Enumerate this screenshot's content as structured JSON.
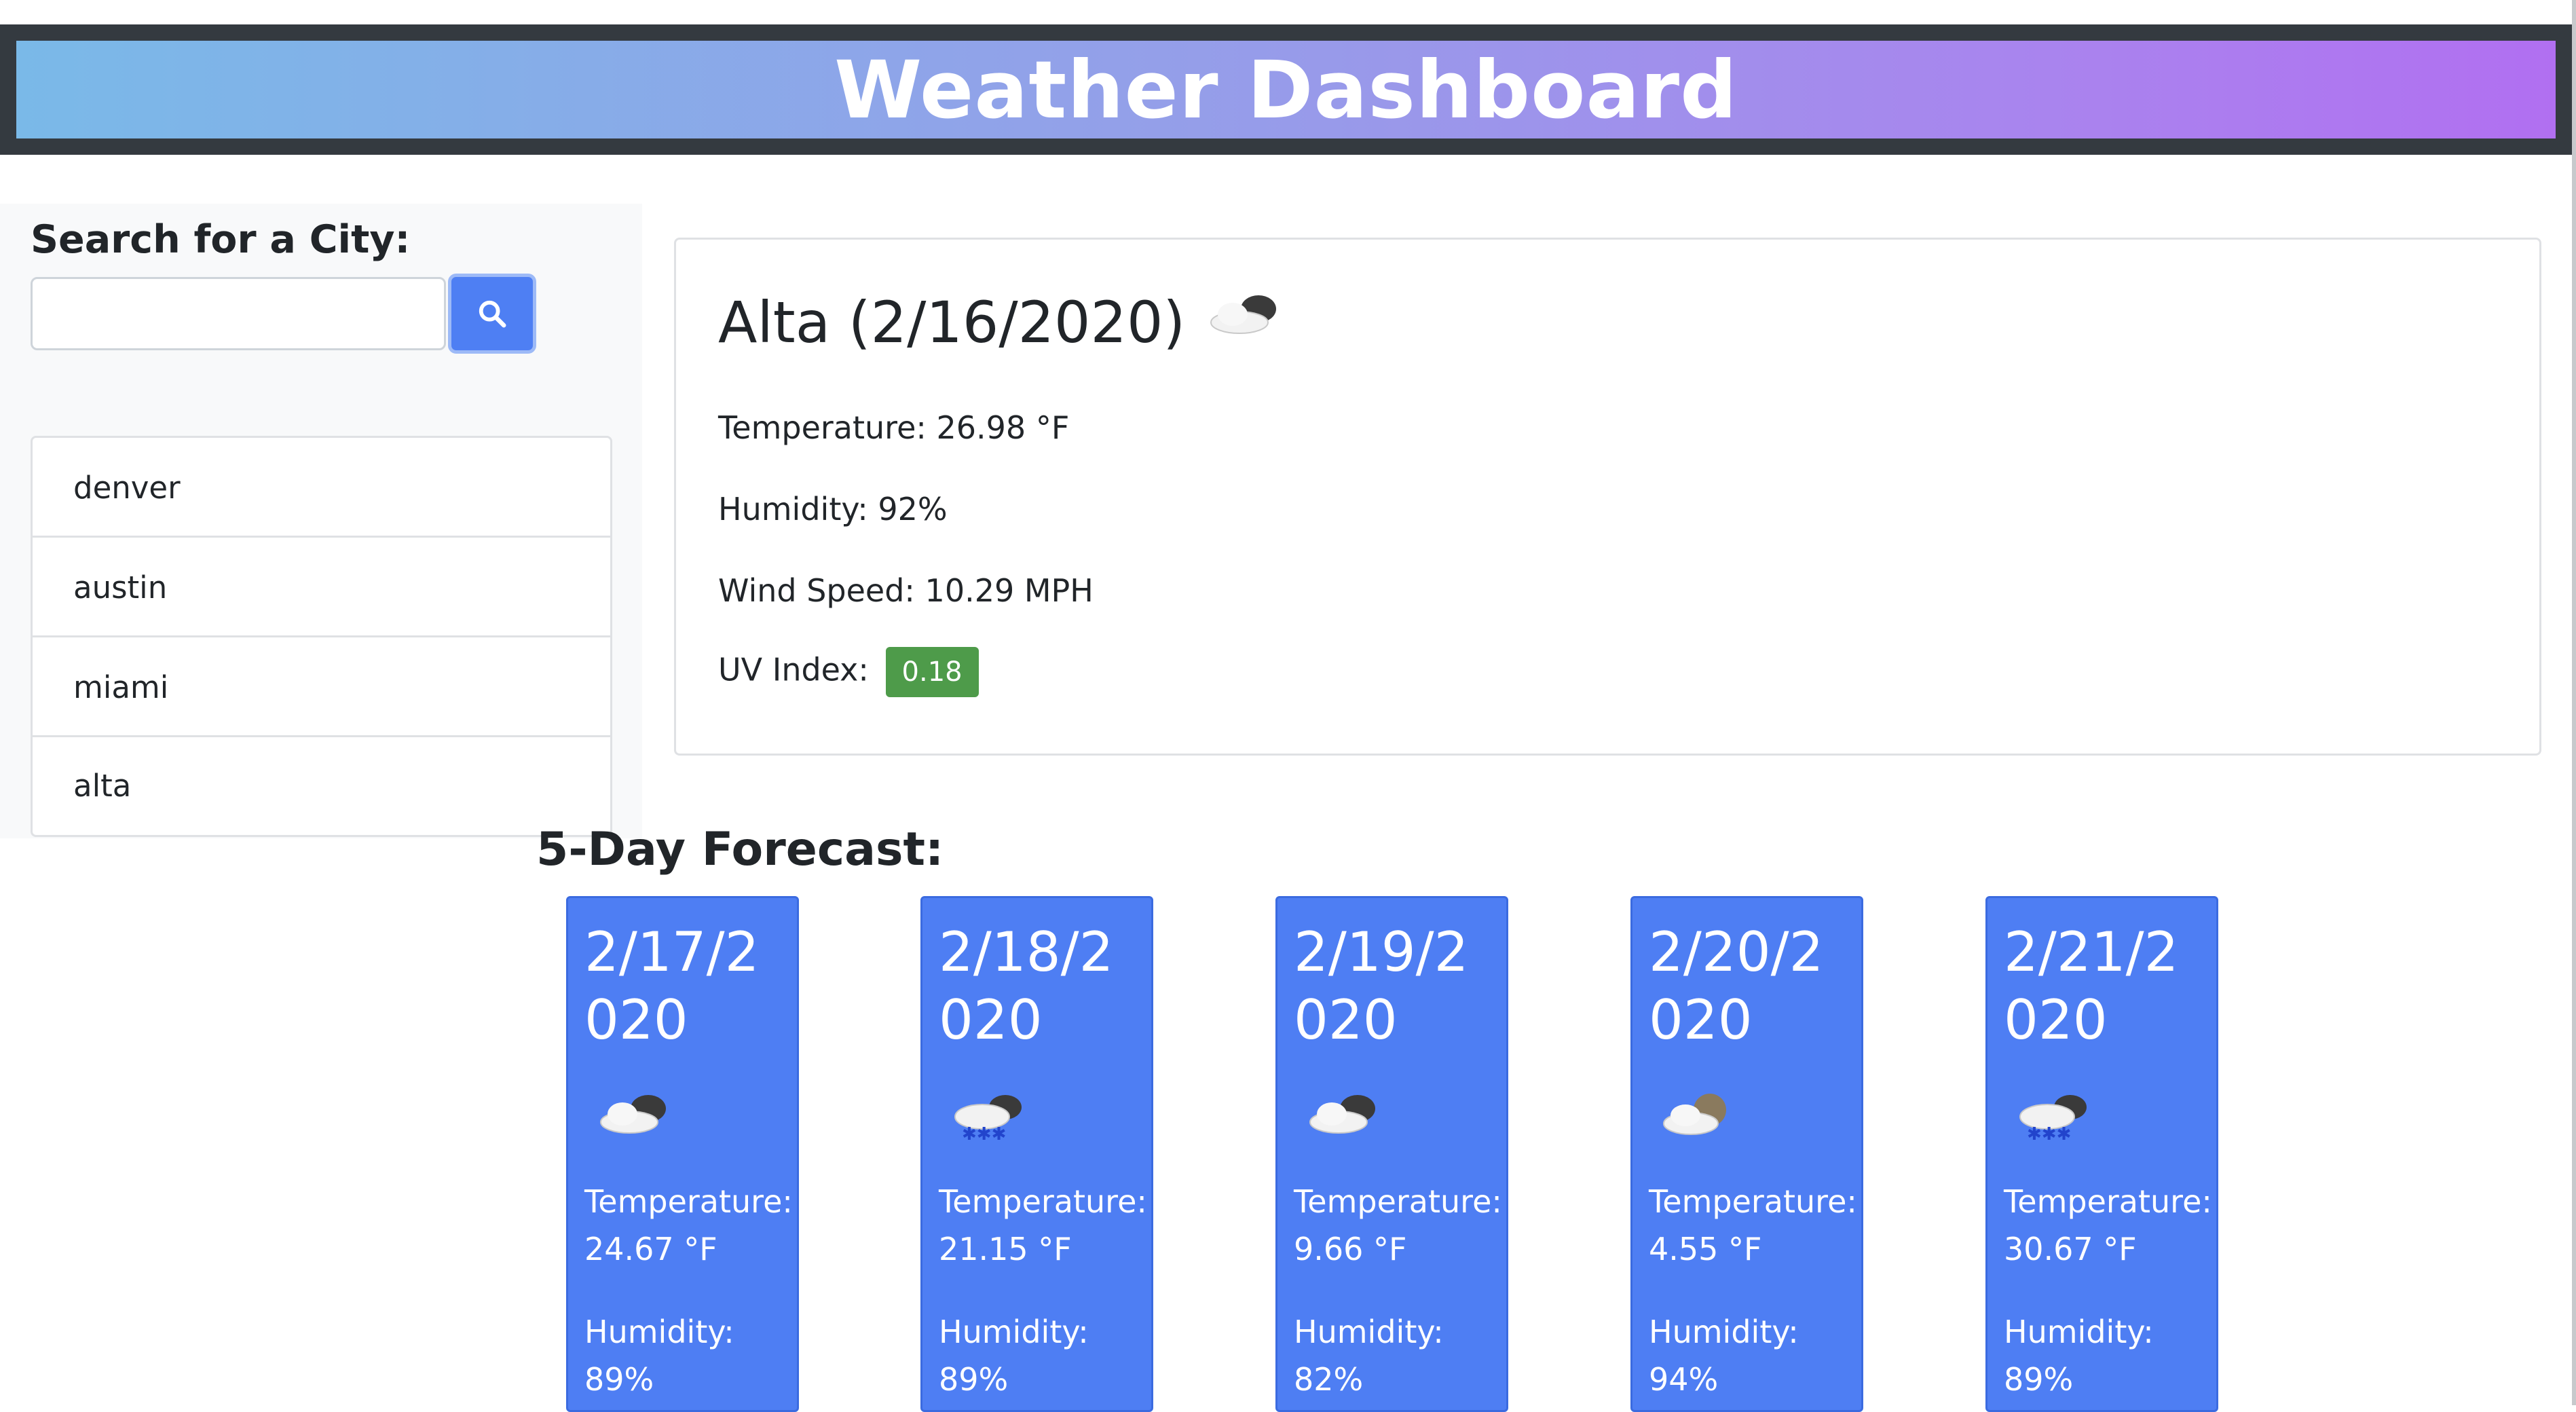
{
  "header": {
    "title": "Weather Dashboard"
  },
  "search": {
    "label": "Search for a City:",
    "input_value": "",
    "placeholder": ""
  },
  "cities": [
    "denver",
    "austin",
    "miami",
    "alta"
  ],
  "current": {
    "heading": "Alta (2/16/2020)",
    "icon": "cloud-partly-icon",
    "temperature": "Temperature: 26.98 °F",
    "humidity": "Humidity: 92%",
    "wind": "Wind Speed: 10.29 MPH",
    "uv_label": "UV Index:",
    "uv_value": "0.18",
    "uv_color": "#4e9b4a"
  },
  "forecast": {
    "title": "5-Day Forecast:",
    "days": [
      {
        "date": "2/17/2020",
        "icon": "cloud-partly-icon",
        "temp_label": "Temperature:",
        "temp": "24.67 °F",
        "hum_label": "Humidity:",
        "humidity": "89%"
      },
      {
        "date": "2/18/2020",
        "icon": "snow-cloud-icon",
        "temp_label": "Temperature:",
        "temp": "21.15 °F",
        "hum_label": "Humidity:",
        "humidity": "89%"
      },
      {
        "date": "2/19/2020",
        "icon": "cloud-partly-icon",
        "temp_label": "Temperature:",
        "temp": "9.66 °F",
        "hum_label": "Humidity:",
        "humidity": "82%"
      },
      {
        "date": "2/20/2020",
        "icon": "cloud-moon-icon",
        "temp_label": "Temperature:",
        "temp": "4.55 °F",
        "hum_label": "Humidity:",
        "humidity": "94%"
      },
      {
        "date": "2/21/2020",
        "icon": "snow-cloud-icon",
        "temp_label": "Temperature:",
        "temp": "30.67 °F",
        "hum_label": "Humidity:",
        "humidity": "89%"
      }
    ]
  },
  "colors": {
    "accent": "#4e7ef3",
    "header_dark": "#343a40"
  }
}
